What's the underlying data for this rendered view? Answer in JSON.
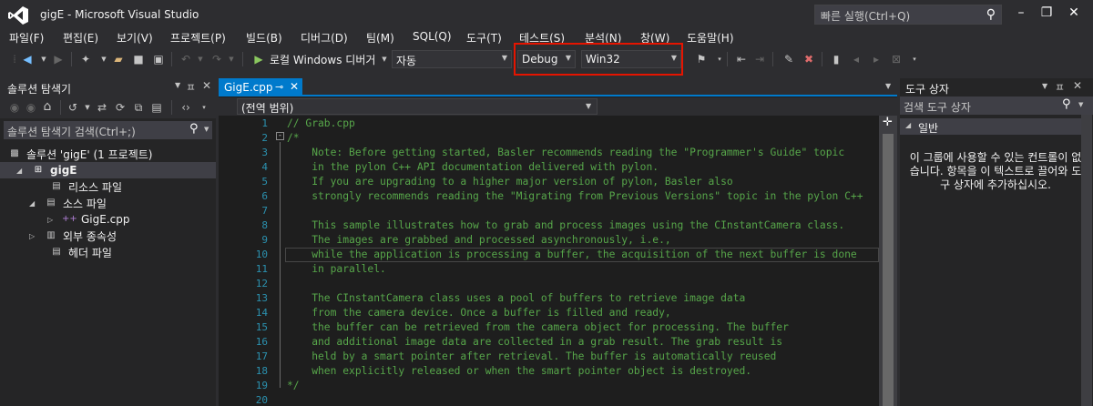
{
  "window": {
    "title": "gigE - Microsoft Visual Studio",
    "quick_launch_placeholder": "빠른 실행(Ctrl+Q)"
  },
  "menu": [
    "파일(F)",
    "편집(E)",
    "보기(V)",
    "프로젝트(P)",
    "빌드(B)",
    "디버그(D)",
    "팀(M)",
    "SQL(Q)",
    "도구(T)",
    "테스트(S)",
    "분석(N)",
    "창(W)",
    "도움말(H)"
  ],
  "toolbar": {
    "start_label": "로컬 Windows 디버거",
    "mode_value": "자동",
    "config_value": "Debug",
    "platform_value": "Win32"
  },
  "solution_explorer": {
    "title": "솔루션 탐색기",
    "search_placeholder": "솔루션 탐색기 검색(Ctrl+;)",
    "solution": "솔루션 'gigE' (1 프로젝트)",
    "project": "gigE",
    "items": [
      {
        "label": "리소스 파일"
      },
      {
        "label": "소스 파일"
      },
      {
        "label": "GigE.cpp"
      },
      {
        "label": "외부 종속성"
      },
      {
        "label": "헤더 파일"
      }
    ]
  },
  "editor": {
    "tab_label": "GigE.cpp",
    "tab_pin": "ㅋ",
    "scope": "(전역 범위)",
    "lines": [
      "// Grab.cpp",
      "/*",
      "    Note: Before getting started, Basler recommends reading the \"Programmer's Guide\" topic",
      "    in the pylon C++ API documentation delivered with pylon.",
      "    If you are upgrading to a higher major version of pylon, Basler also",
      "    strongly recommends reading the \"Migrating from Previous Versions\" topic in the pylon C++",
      "",
      "    This sample illustrates how to grab and process images using the CInstantCamera class.",
      "    The images are grabbed and processed asynchronously, i.e.,",
      "    while the application is processing a buffer, the acquisition of the next buffer is done",
      "    in parallel.",
      "",
      "    The CInstantCamera class uses a pool of buffers to retrieve image data",
      "    from the camera device. Once a buffer is filled and ready,",
      "    the buffer can be retrieved from the camera object for processing. The buffer",
      "    and additional image data are collected in a grab result. The grab result is",
      "    held by a smart pointer after retrieval. The buffer is automatically reused",
      "    when explicitly released or when the smart pointer object is destroyed.",
      "*/",
      ""
    ],
    "line_numbers": [
      "1",
      "2",
      "3",
      "4",
      "5",
      "6",
      "7",
      "8",
      "9",
      "10",
      "11",
      "12",
      "13",
      "14",
      "15",
      "16",
      "17",
      "18",
      "19",
      "20"
    ]
  },
  "toolbox": {
    "title": "도구 상자",
    "search_placeholder": "검색 도구 상자",
    "group": "일반",
    "message": "이 그룹에 사용할 수 있는 컨트롤이 없습니다. 항목을 이 텍스트로 끌어와 도구 상자에 추가하십시오."
  },
  "colors": {
    "accent": "#007acc",
    "highlight_box": "#e51400",
    "comment": "#57a64a",
    "line_number": "#2b91af"
  }
}
